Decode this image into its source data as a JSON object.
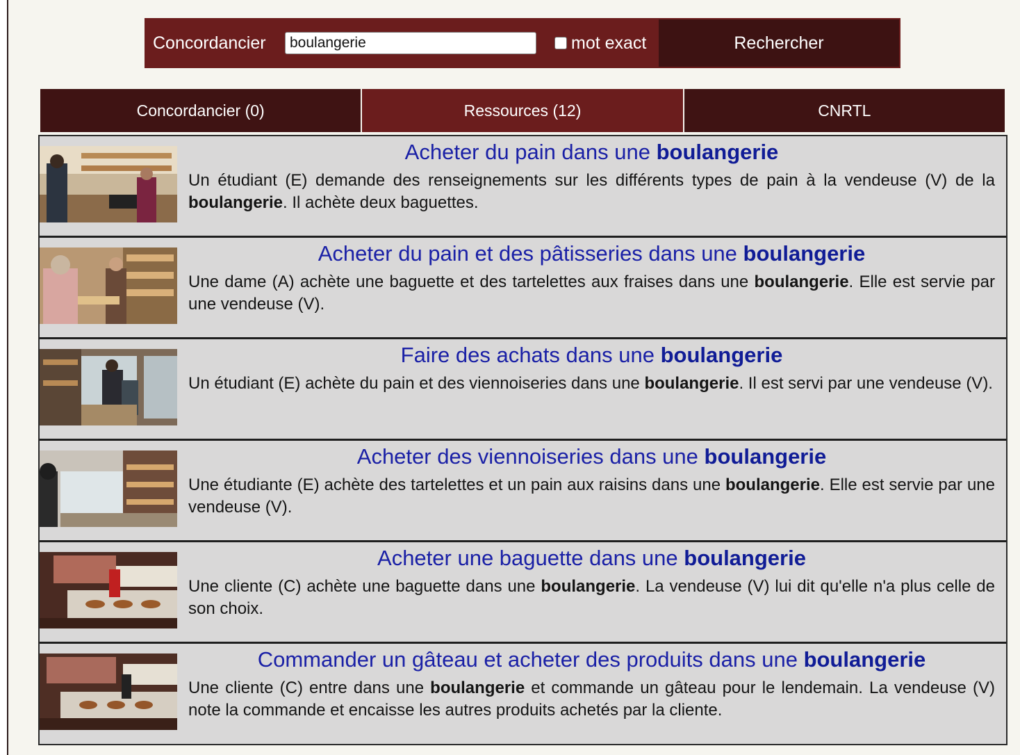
{
  "search": {
    "label": "Concordancier",
    "query": "boulangerie",
    "exact_label": "mot exact",
    "exact_checked": false,
    "button_label": "Rechercher"
  },
  "tabs": [
    {
      "label": "Concordancier (0)",
      "active": false
    },
    {
      "label": "Ressources (12)",
      "active": true
    },
    {
      "label": "CNRTL",
      "active": false
    }
  ],
  "results": [
    {
      "title_pre": "Acheter du pain dans une ",
      "title_kw": "boulangerie",
      "desc_pre": "Un étudiant (E) demande des renseignements sur les différents types de pain à la vendeuse (V) de la ",
      "desc_kw": "boulangerie",
      "desc_post": ". Il achète deux baguettes."
    },
    {
      "title_pre": "Acheter du pain et des pâtisseries dans une ",
      "title_kw": "boulangerie",
      "desc_pre": "Une dame (A) achète une baguette et des tartelettes aux fraises dans une ",
      "desc_kw": "boulangerie",
      "desc_post": ". Elle est servie par une vendeuse (V)."
    },
    {
      "title_pre": "Faire des achats dans une ",
      "title_kw": "boulangerie",
      "desc_pre": "Un étudiant (E) achète du pain et des viennoiseries dans une ",
      "desc_kw": "boulangerie",
      "desc_post": ". Il est servi par une vendeuse (V)."
    },
    {
      "title_pre": "Acheter des viennoiseries dans une ",
      "title_kw": "boulangerie",
      "desc_pre": "Une étudiante (E) achète des tartelettes et un pain aux raisins dans une ",
      "desc_kw": "boulangerie",
      "desc_post": ". Elle est servie par une vendeuse (V)."
    },
    {
      "title_pre": "Acheter une baguette dans une ",
      "title_kw": "boulangerie",
      "desc_pre": "Une cliente (C) achète une baguette dans une ",
      "desc_kw": "boulangerie",
      "desc_post": ". La vendeuse (V) lui dit qu'elle n'a plus celle de son choix."
    },
    {
      "title_pre": "Commander un gâteau et acheter des produits dans une ",
      "title_kw": "boulangerie",
      "desc_pre": "Une cliente (C) entre dans une ",
      "desc_kw": "boulangerie",
      "desc_post": " et commande un gâteau pour le lendemain. La vendeuse (V) note la commande et encaisse les autres produits achetés par la cliente."
    }
  ],
  "colors": {
    "header_bg": "#6b1d1d",
    "tab_dark": "#3f1313",
    "link": "#1a20a6",
    "card_bg": "#d9d8d8"
  }
}
